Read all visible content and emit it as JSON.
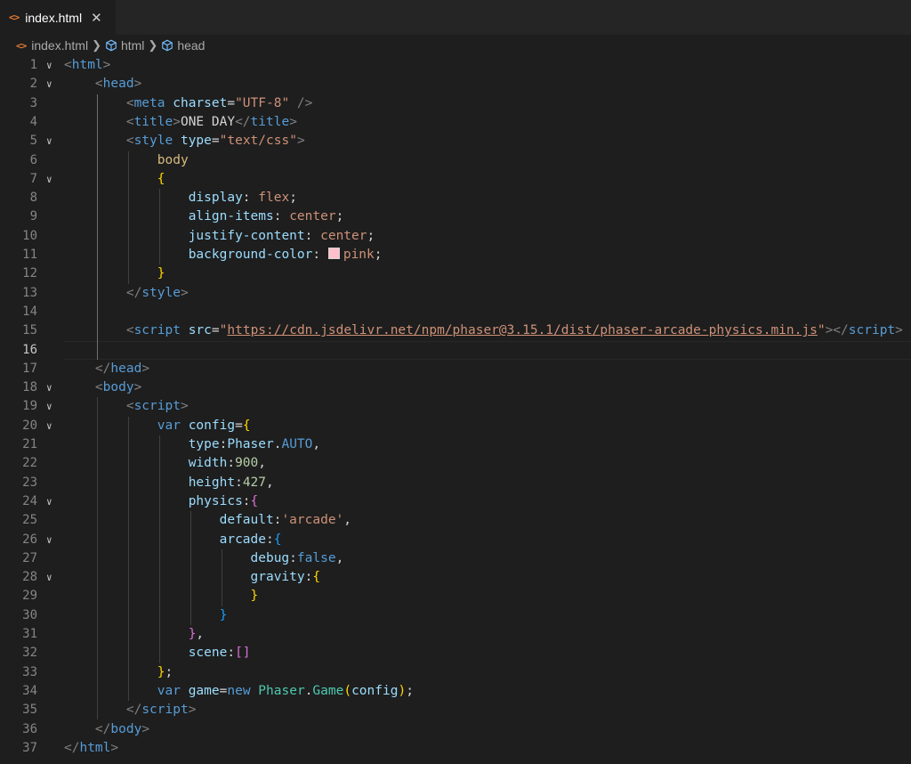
{
  "tab": {
    "label": "index.html",
    "close": "✕",
    "icon": "<>"
  },
  "breadcrumb": {
    "file": "index.html",
    "items": [
      "html",
      "head"
    ],
    "icon": "<>"
  },
  "colors": {
    "background": "#1e1e1e",
    "tabbar": "#252526",
    "html_icon": "#e37933",
    "swatch": "#ffc0cb"
  },
  "editor": {
    "active_line": 16,
    "lines": [
      {
        "n": "1",
        "fold": "v",
        "tokens": [
          [
            "t-brk",
            "<"
          ],
          [
            "t-tag",
            "html"
          ],
          [
            "t-brk",
            ">"
          ]
        ]
      },
      {
        "n": "2",
        "fold": "v",
        "tokens": [
          [
            "t-txt",
            "    "
          ],
          [
            "t-brk",
            "<"
          ],
          [
            "t-tag",
            "head"
          ],
          [
            "t-brk",
            ">"
          ]
        ]
      },
      {
        "n": "3",
        "tokens": [
          [
            "t-txt",
            "        "
          ],
          [
            "t-brk",
            "<"
          ],
          [
            "t-tag",
            "meta"
          ],
          [
            "t-txt",
            " "
          ],
          [
            "t-attr",
            "charset"
          ],
          [
            "t-txt",
            "="
          ],
          [
            "t-str",
            "\"UTF-8\""
          ],
          [
            "t-txt",
            " "
          ],
          [
            "t-brk",
            "/>"
          ]
        ]
      },
      {
        "n": "4",
        "tokens": [
          [
            "t-txt",
            "        "
          ],
          [
            "t-brk",
            "<"
          ],
          [
            "t-tag",
            "title"
          ],
          [
            "t-brk",
            ">"
          ],
          [
            "t-txt",
            "ONE DAY"
          ],
          [
            "t-brk",
            "</"
          ],
          [
            "t-tag",
            "title"
          ],
          [
            "t-brk",
            ">"
          ]
        ]
      },
      {
        "n": "5",
        "fold": "v",
        "tokens": [
          [
            "t-txt",
            "        "
          ],
          [
            "t-brk",
            "<"
          ],
          [
            "t-tag",
            "style"
          ],
          [
            "t-txt",
            " "
          ],
          [
            "t-attr",
            "type"
          ],
          [
            "t-txt",
            "="
          ],
          [
            "t-str",
            "\"text/css\""
          ],
          [
            "t-brk",
            ">"
          ]
        ]
      },
      {
        "n": "6",
        "tokens": [
          [
            "t-txt",
            "            "
          ],
          [
            "t-sel",
            "body"
          ]
        ]
      },
      {
        "n": "7",
        "fold": "v",
        "tokens": [
          [
            "t-txt",
            "            "
          ],
          [
            "t-b1",
            "{"
          ]
        ]
      },
      {
        "n": "8",
        "tokens": [
          [
            "t-txt",
            "                "
          ],
          [
            "t-prop",
            "display"
          ],
          [
            "t-txt",
            ": "
          ],
          [
            "t-val",
            "flex"
          ],
          [
            "t-txt",
            ";"
          ]
        ]
      },
      {
        "n": "9",
        "tokens": [
          [
            "t-txt",
            "                "
          ],
          [
            "t-prop",
            "align-items"
          ],
          [
            "t-txt",
            ": "
          ],
          [
            "t-val",
            "center"
          ],
          [
            "t-txt",
            ";"
          ]
        ]
      },
      {
        "n": "10",
        "tokens": [
          [
            "t-txt",
            "                "
          ],
          [
            "t-prop",
            "justify-content"
          ],
          [
            "t-txt",
            ": "
          ],
          [
            "t-val",
            "center"
          ],
          [
            "t-txt",
            ";"
          ]
        ]
      },
      {
        "n": "11",
        "tokens": [
          [
            "t-txt",
            "                "
          ],
          [
            "t-prop",
            "background-color"
          ],
          [
            "t-txt",
            ": "
          ],
          [
            "swatch",
            ""
          ],
          [
            "t-val",
            "pink"
          ],
          [
            "t-txt",
            ";"
          ]
        ]
      },
      {
        "n": "12",
        "tokens": [
          [
            "t-txt",
            "            "
          ],
          [
            "t-b1",
            "}"
          ]
        ]
      },
      {
        "n": "13",
        "tokens": [
          [
            "t-txt",
            "        "
          ],
          [
            "t-brk",
            "</"
          ],
          [
            "t-tag",
            "style"
          ],
          [
            "t-brk",
            ">"
          ]
        ]
      },
      {
        "n": "14",
        "tokens": []
      },
      {
        "n": "15",
        "tokens": [
          [
            "t-txt",
            "        "
          ],
          [
            "t-brk",
            "<"
          ],
          [
            "t-tag",
            "script"
          ],
          [
            "t-txt",
            " "
          ],
          [
            "t-attr",
            "src"
          ],
          [
            "t-txt",
            "="
          ],
          [
            "t-str",
            "\""
          ],
          [
            "t-str t-url",
            "https://cdn.jsdelivr.net/npm/phaser@3.15.1/dist/phaser-arcade-physics.min.js"
          ],
          [
            "t-str",
            "\""
          ],
          [
            "t-brk",
            "></"
          ],
          [
            "t-tag",
            "script"
          ],
          [
            "t-brk",
            ">"
          ]
        ]
      },
      {
        "n": "16",
        "tokens": []
      },
      {
        "n": "17",
        "tokens": [
          [
            "t-txt",
            "    "
          ],
          [
            "t-brk",
            "</"
          ],
          [
            "t-tag",
            "head"
          ],
          [
            "t-brk",
            ">"
          ]
        ]
      },
      {
        "n": "18",
        "fold": "v",
        "tokens": [
          [
            "t-txt",
            "    "
          ],
          [
            "t-brk",
            "<"
          ],
          [
            "t-tag",
            "body"
          ],
          [
            "t-brk",
            ">"
          ]
        ]
      },
      {
        "n": "19",
        "fold": "v",
        "tokens": [
          [
            "t-txt",
            "        "
          ],
          [
            "t-brk",
            "<"
          ],
          [
            "t-tag",
            "script"
          ],
          [
            "t-brk",
            ">"
          ]
        ]
      },
      {
        "n": "20",
        "fold": "v",
        "tokens": [
          [
            "t-txt",
            "            "
          ],
          [
            "t-kw",
            "var"
          ],
          [
            "t-txt",
            " "
          ],
          [
            "t-var",
            "config"
          ],
          [
            "t-txt",
            "="
          ],
          [
            "t-b1",
            "{"
          ]
        ]
      },
      {
        "n": "21",
        "tokens": [
          [
            "t-txt",
            "                "
          ],
          [
            "t-var",
            "type"
          ],
          [
            "t-txt",
            ":"
          ],
          [
            "t-var",
            "Phaser"
          ],
          [
            "t-txt",
            "."
          ],
          [
            "t-kw",
            "AUTO"
          ],
          [
            "t-txt",
            ","
          ]
        ]
      },
      {
        "n": "22",
        "tokens": [
          [
            "t-txt",
            "                "
          ],
          [
            "t-var",
            "width"
          ],
          [
            "t-txt",
            ":"
          ],
          [
            "t-num",
            "900"
          ],
          [
            "t-txt",
            ","
          ]
        ]
      },
      {
        "n": "23",
        "tokens": [
          [
            "t-txt",
            "                "
          ],
          [
            "t-var",
            "height"
          ],
          [
            "t-txt",
            ":"
          ],
          [
            "t-num",
            "427"
          ],
          [
            "t-txt",
            ","
          ]
        ]
      },
      {
        "n": "24",
        "fold": "v",
        "tokens": [
          [
            "t-txt",
            "                "
          ],
          [
            "t-var",
            "physics"
          ],
          [
            "t-txt",
            ":"
          ],
          [
            "t-b2",
            "{"
          ]
        ]
      },
      {
        "n": "25",
        "tokens": [
          [
            "t-txt",
            "                    "
          ],
          [
            "t-var",
            "default"
          ],
          [
            "t-txt",
            ":"
          ],
          [
            "t-str",
            "'arcade'"
          ],
          [
            "t-txt",
            ","
          ]
        ]
      },
      {
        "n": "26",
        "fold": "v",
        "tokens": [
          [
            "t-txt",
            "                    "
          ],
          [
            "t-var",
            "arcade"
          ],
          [
            "t-txt",
            ":"
          ],
          [
            "t-b3",
            "{"
          ]
        ]
      },
      {
        "n": "27",
        "tokens": [
          [
            "t-txt",
            "                        "
          ],
          [
            "t-var",
            "debug"
          ],
          [
            "t-txt",
            ":"
          ],
          [
            "t-kw",
            "false"
          ],
          [
            "t-txt",
            ","
          ]
        ]
      },
      {
        "n": "28",
        "fold": "v",
        "tokens": [
          [
            "t-txt",
            "                        "
          ],
          [
            "t-var",
            "gravity"
          ],
          [
            "t-txt",
            ":"
          ],
          [
            "t-b1",
            "{"
          ]
        ]
      },
      {
        "n": "29",
        "tokens": [
          [
            "t-txt",
            "                        "
          ],
          [
            "t-b1",
            "}"
          ]
        ]
      },
      {
        "n": "30",
        "tokens": [
          [
            "t-txt",
            "                    "
          ],
          [
            "t-b3",
            "}"
          ]
        ]
      },
      {
        "n": "31",
        "tokens": [
          [
            "t-txt",
            "                "
          ],
          [
            "t-b2",
            "}"
          ],
          [
            "t-txt",
            ","
          ]
        ]
      },
      {
        "n": "32",
        "tokens": [
          [
            "t-txt",
            "                "
          ],
          [
            "t-var",
            "scene"
          ],
          [
            "t-txt",
            ":"
          ],
          [
            "t-b2",
            "[]"
          ]
        ]
      },
      {
        "n": "33",
        "tokens": [
          [
            "t-txt",
            "            "
          ],
          [
            "t-b1",
            "}"
          ],
          [
            "t-txt",
            ";"
          ]
        ]
      },
      {
        "n": "34",
        "tokens": [
          [
            "t-txt",
            "            "
          ],
          [
            "t-kw",
            "var"
          ],
          [
            "t-txt",
            " "
          ],
          [
            "t-var",
            "game"
          ],
          [
            "t-txt",
            "="
          ],
          [
            "t-kw",
            "new"
          ],
          [
            "t-txt",
            " "
          ],
          [
            "t-cls",
            "Phaser"
          ],
          [
            "t-txt",
            "."
          ],
          [
            "t-cls",
            "Game"
          ],
          [
            "t-b1",
            "("
          ],
          [
            "t-var",
            "config"
          ],
          [
            "t-b1",
            ")"
          ],
          [
            "t-txt",
            ";"
          ]
        ]
      },
      {
        "n": "35",
        "tokens": [
          [
            "t-txt",
            "        "
          ],
          [
            "t-brk",
            "</"
          ],
          [
            "t-tag",
            "script"
          ],
          [
            "t-brk",
            ">"
          ]
        ]
      },
      {
        "n": "36",
        "tokens": [
          [
            "t-txt",
            "    "
          ],
          [
            "t-brk",
            "</"
          ],
          [
            "t-tag",
            "body"
          ],
          [
            "t-brk",
            ">"
          ]
        ]
      },
      {
        "n": "37",
        "tokens": [
          [
            "t-brk",
            "</"
          ],
          [
            "t-tag",
            "html"
          ],
          [
            "t-brk",
            ">"
          ]
        ]
      }
    ]
  }
}
